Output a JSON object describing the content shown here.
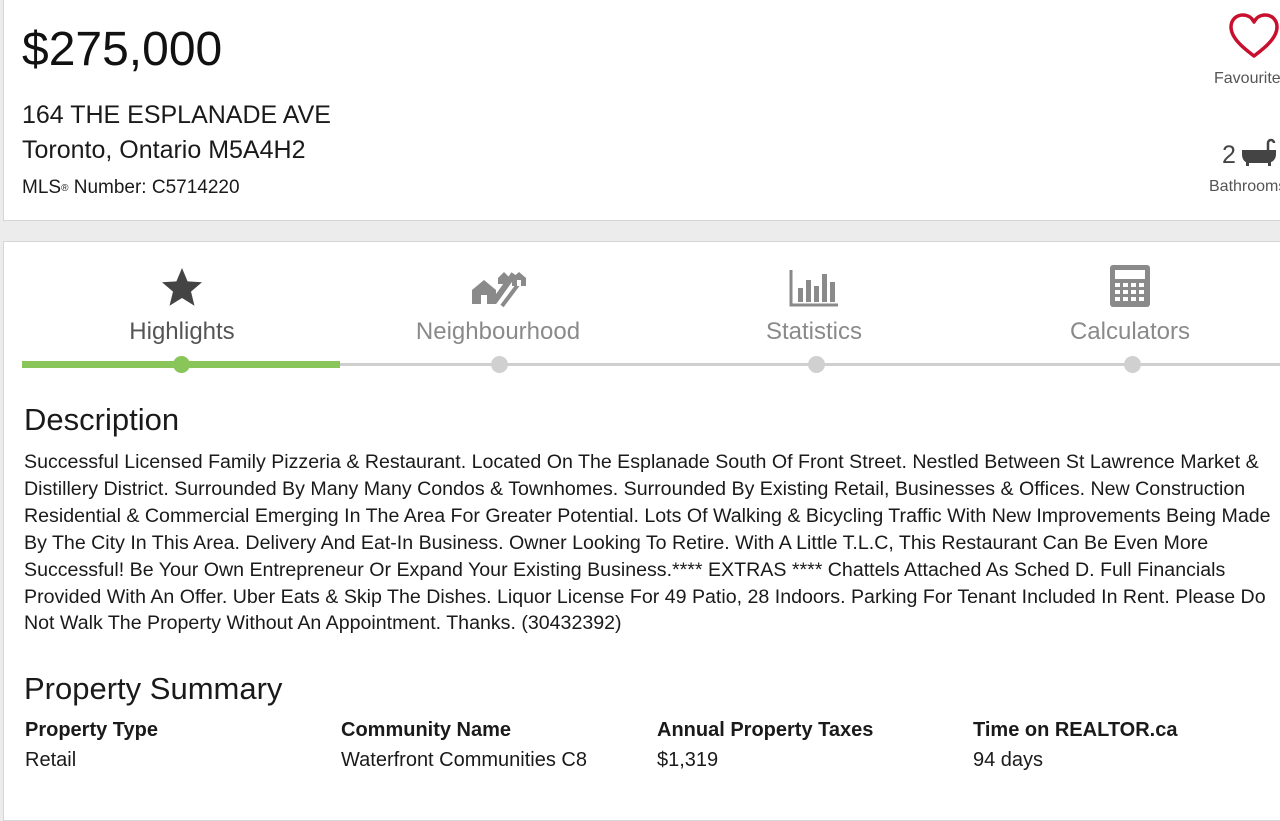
{
  "listing": {
    "price": "$275,000",
    "address_line1": "164 THE ESPLANADE AVE",
    "address_line2": "Toronto, Ontario M5A4H2",
    "mls_prefix": "MLS",
    "mls_reg": "®",
    "mls_label": " Number: C5714220",
    "favourite_label": "Favourite",
    "bathrooms_count": "2",
    "bathrooms_label": "Bathrooms"
  },
  "tabs": [
    {
      "label": "Highlights",
      "icon": "star-icon",
      "active": true
    },
    {
      "label": "Neighbourhood",
      "icon": "neighbourhood-icon",
      "active": false
    },
    {
      "label": "Statistics",
      "icon": "bar-chart-icon",
      "active": false
    },
    {
      "label": "Calculators",
      "icon": "calculator-icon",
      "active": false
    }
  ],
  "description": {
    "heading": "Description",
    "text": "Successful Licensed Family Pizzeria & Restaurant. Located On The Esplanade South Of Front Street. Nestled Between St Lawrence Market & Distillery District. Surrounded By Many Many Condos & Townhomes. Surrounded By Existing Retail, Businesses & Offices. New Construction Residential & Commercial Emerging In The Area For Greater Potential. Lots Of Walking & Bicycling Traffic With New Improvements Being Made By The City In This Area. Delivery And Eat-In Business. Owner Looking To Retire. With A Little T.L.C, This Restaurant Can Be Even More Successful! Be Your Own Entrepreneur Or Expand Your Existing Business.**** EXTRAS **** Chattels Attached As Sched D. Full Financials Provided With An Offer. Uber Eats & Skip The Dishes. Liquor License For 49 Patio, 28 Indoors. Parking For Tenant Included In Rent. Please Do Not Walk The Property Without An Appointment. Thanks. (30432392)"
  },
  "summary": {
    "heading": "Property Summary",
    "items": [
      {
        "label": "Property Type",
        "value": "Retail"
      },
      {
        "label": "Community Name",
        "value": "Waterfront Communities C8"
      },
      {
        "label": "Annual Property Taxes",
        "value": "$1,319"
      },
      {
        "label": "Time on REALTOR.ca",
        "value": "94 days"
      }
    ]
  },
  "colors": {
    "accent": "#8ac55a",
    "favourite": "#c8102e"
  }
}
